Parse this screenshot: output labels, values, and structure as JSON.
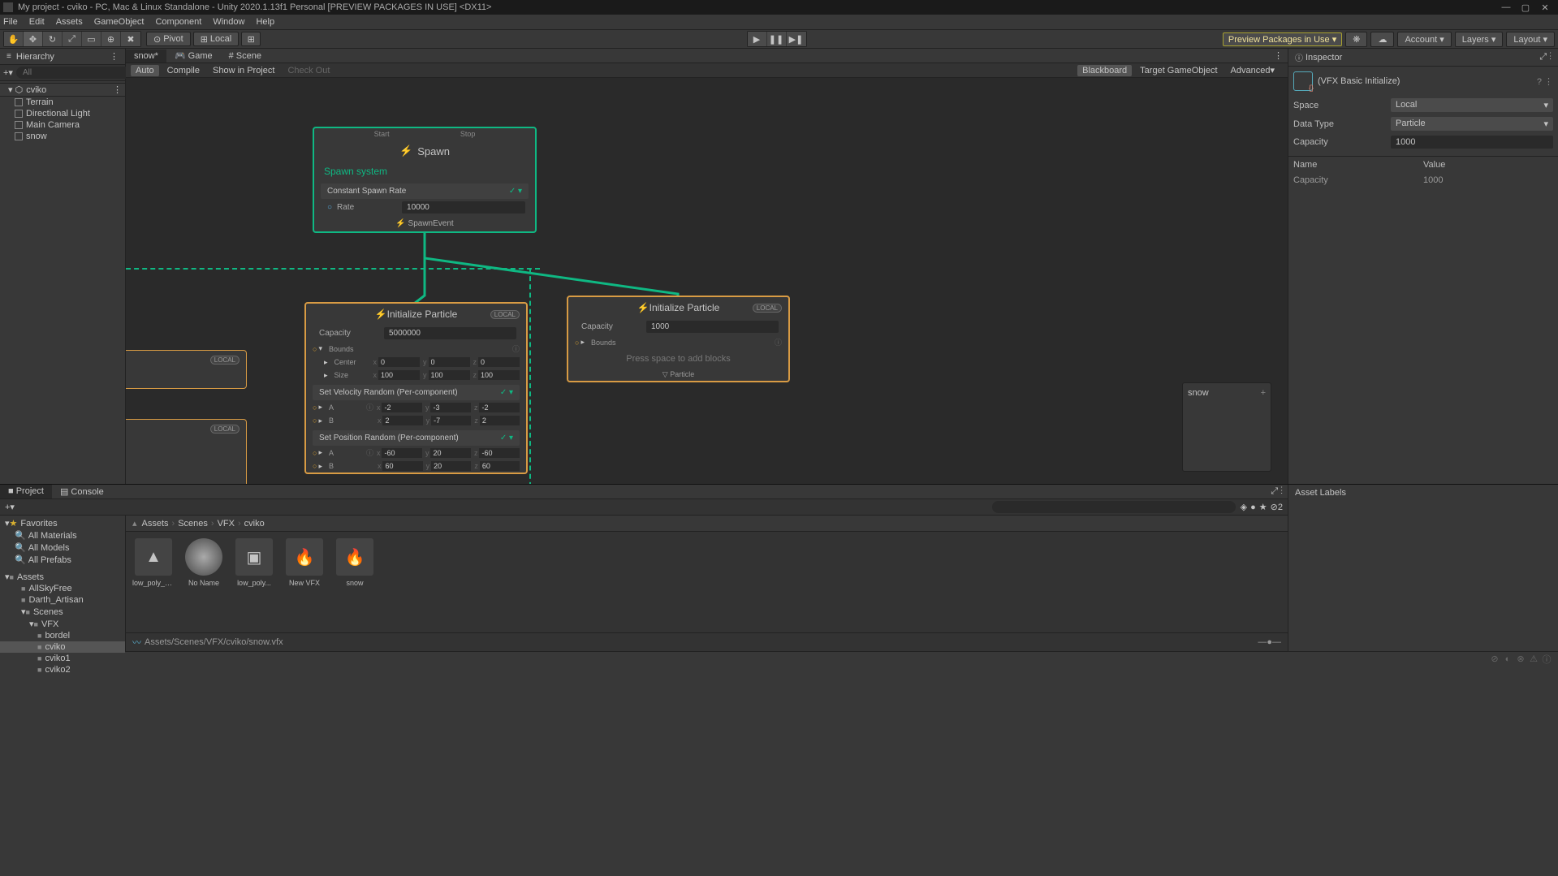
{
  "title": "My project - cviko - PC, Mac & Linux Standalone - Unity 2020.1.13f1 Personal [PREVIEW PACKAGES IN USE] <DX11>",
  "menu": [
    "File",
    "Edit",
    "Assets",
    "GameObject",
    "Component",
    "Window",
    "Help"
  ],
  "toolbar": {
    "pivot": "Pivot",
    "local": "Local",
    "preview": "Preview Packages in Use ▾",
    "account": "Account",
    "layers": "Layers",
    "layout": "Layout"
  },
  "hierarchy": {
    "title": "Hierarchy",
    "searchPlaceholder": "All",
    "scene": "cviko",
    "items": [
      "Terrain",
      "Directional Light",
      "Main Camera",
      "snow"
    ]
  },
  "tabs": {
    "snow": "snow*",
    "game": "Game",
    "scene": "Scene"
  },
  "vfxbar": {
    "auto": "Auto",
    "compile": "Compile",
    "show": "Show in Project",
    "checkout": "Check Out",
    "blackboard": "Blackboard",
    "target": "Target GameObject",
    "advanced": "Advanced▾"
  },
  "spawn": {
    "start": "Start",
    "stop": "Stop",
    "title": "Spawn",
    "system": "Spawn system",
    "block": "Constant Spawn Rate",
    "rateLabel": "Rate",
    "rate": "10000",
    "event": "SpawnEvent"
  },
  "init1": {
    "title": "Initialize Particle",
    "local": "LOCAL",
    "capLabel": "Capacity",
    "capacity": "5000000",
    "boundsLabel": "Bounds",
    "centerLabel": "Center",
    "center": {
      "x": "0",
      "y": "0",
      "z": "0"
    },
    "sizeLabel": "Size",
    "size": {
      "x": "100",
      "y": "100",
      "z": "100"
    },
    "velBlock": "Set Velocity Random (Per-component)",
    "aLabel": "A",
    "bLabel": "B",
    "velA": {
      "x": "-2",
      "y": "-3",
      "z": "-2"
    },
    "velB": {
      "x": "2",
      "y": "-7",
      "z": "2"
    },
    "posBlock": "Set Position Random (Per-component)",
    "posA": {
      "x": "-60",
      "y": "20",
      "z": "-60"
    },
    "posB": {
      "x": "60",
      "y": "20",
      "z": "60"
    }
  },
  "init2": {
    "title": "Initialize Particle",
    "local": "LOCAL",
    "capLabel": "Capacity",
    "capacity": "1000",
    "boundsLabel": "Bounds",
    "addHint": "Press space to add blocks",
    "particle": "Particle"
  },
  "floatWin": {
    "title": "snow"
  },
  "inspector": {
    "title": "Inspector",
    "name": "(VFX Basic Initialize)",
    "props": {
      "spaceLabel": "Space",
      "space": "Local",
      "dataTypeLabel": "Data Type",
      "dataType": "Particle",
      "capacityLabel": "Capacity",
      "capacity": "1000"
    },
    "colName": "Name",
    "colValue": "Value",
    "rowName": "Capacity",
    "rowValue": "1000"
  },
  "project": {
    "tab1": "Project",
    "tab2": "Console",
    "favorites": "Favorites",
    "favItems": [
      "All Materials",
      "All Models",
      "All Prefabs"
    ],
    "assets": "Assets",
    "folders": [
      "AllSkyFree",
      "Darth_Artisan",
      "Scenes"
    ],
    "vfx": "VFX",
    "vfxFolders": [
      "bordel",
      "cviko",
      "cviko1",
      "cviko2"
    ],
    "breadcrumb": [
      "Assets",
      "Scenes",
      "VFX",
      "cviko"
    ],
    "files": [
      "low_poly_s...",
      "No Name",
      "low_poly...",
      "New VFX",
      "snow"
    ],
    "path": "Assets/Scenes/VFX/cviko/snow.vfx",
    "hidden": "2",
    "assetLabels": "Asset Labels"
  }
}
